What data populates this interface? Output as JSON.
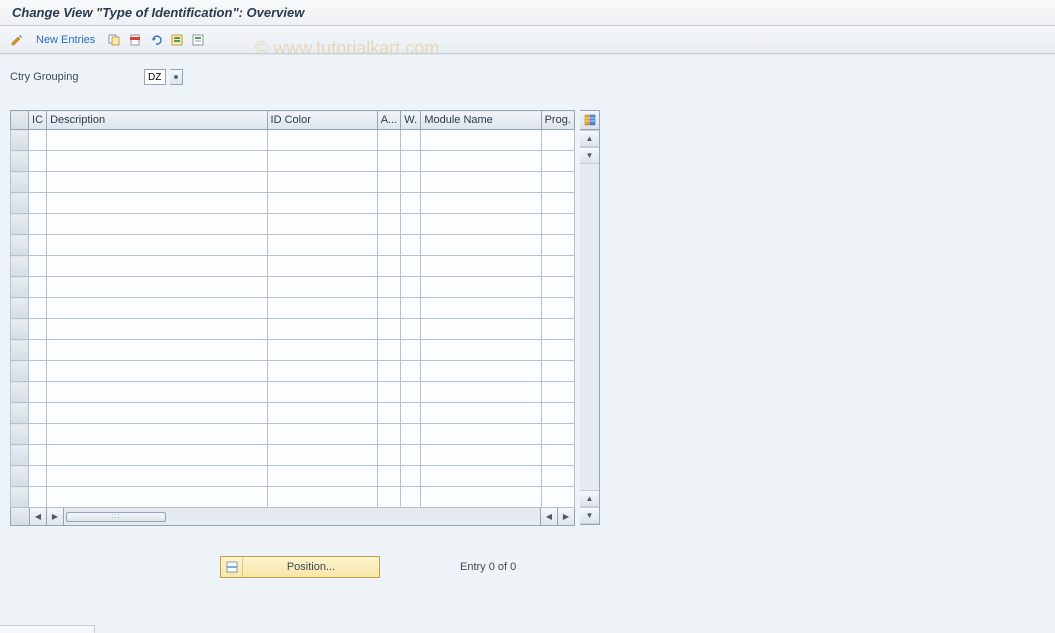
{
  "title": "Change View \"Type of Identification\": Overview",
  "watermark": "© www.tutorialkart.com",
  "toolbar": {
    "new_entries": "New Entries"
  },
  "fields": {
    "ctry_grouping_label": "Ctry Grouping",
    "ctry_grouping_value": "DZ"
  },
  "table": {
    "headers": {
      "ic": "IC",
      "description": "Description",
      "idcolor": "ID Color",
      "a": "A...",
      "w": "W.",
      "module": "Module Name",
      "prog": "Prog."
    },
    "row_count": 18
  },
  "footer": {
    "position_label": "Position...",
    "entry_status": "Entry 0 of 0"
  }
}
